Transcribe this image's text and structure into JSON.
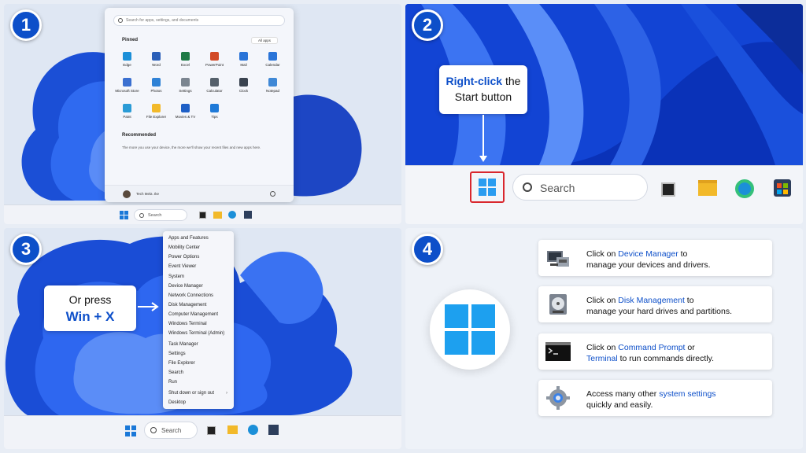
{
  "badges": [
    "1",
    "2",
    "3",
    "4"
  ],
  "panel1": {
    "search_placeholder": "Search for apps, settings, and documents",
    "pinned_label": "Pinned",
    "all_apps_label": "All apps",
    "apps": [
      {
        "label": "Edge",
        "color": "#1b8fd8"
      },
      {
        "label": "Word",
        "color": "#2b5fb8"
      },
      {
        "label": "Excel",
        "color": "#1f7a46"
      },
      {
        "label": "PowerPoint",
        "color": "#d24a26"
      },
      {
        "label": "Mail",
        "color": "#2a74d8"
      },
      {
        "label": "Calendar",
        "color": "#2a74d8"
      },
      {
        "label": "Microsoft Store",
        "color": "#3a6fd0"
      },
      {
        "label": "Photos",
        "color": "#2f82d6"
      },
      {
        "label": "Settings",
        "color": "#7b8590"
      },
      {
        "label": "Calculator",
        "color": "#55606b"
      },
      {
        "label": "Clock",
        "color": "#3a4350"
      },
      {
        "label": "Notepad",
        "color": "#3f88d6"
      },
      {
        "label": "Paint",
        "color": "#2a9bd6"
      },
      {
        "label": "File Explorer",
        "color": "#f2b92a"
      },
      {
        "label": "Movies & TV",
        "color": "#1e5fc6"
      },
      {
        "label": "Tips",
        "color": "#1f7ad8"
      }
    ],
    "recommended_label": "Recommended",
    "recommended_text": "The more you use your device, the more we'll show your recent files and new apps here.",
    "user_name": "Tech Mela .Ike",
    "taskbar_search": "Search"
  },
  "panel2": {
    "callout_bold": "Right-click",
    "callout_rest": " the",
    "callout_line2": "Start button",
    "taskbar_search": "Search"
  },
  "panel3": {
    "menu_items": [
      "Apps and Features",
      "Mobility Center",
      "Power Options",
      "Event Viewer",
      "System",
      "Device Manager",
      "Network Connections",
      "Disk Management",
      "Computer Management",
      "Windows Terminal",
      "Windows Terminal (Admin)",
      "Task Manager",
      "Settings",
      "File Explorer",
      "Search",
      "Run",
      "Shut down or sign out",
      "Desktop"
    ],
    "callout_line1": "Or press",
    "callout_line2": "Win + X",
    "taskbar_search": "Search"
  },
  "panel4": {
    "cards": [
      {
        "pre": "Click on ",
        "link": "Device Manager",
        "post": " to",
        "line2": "manage your devices and drivers.",
        "icon": "device-manager-icon"
      },
      {
        "pre": "Click on ",
        "link": "Disk Management",
        "post": " to",
        "line2": "manage your hard drives and partitions.",
        "icon": "disk-management-icon"
      },
      {
        "pre": "Click on ",
        "link": "Command Prompt",
        "post": " or",
        "line2_link": "Terminal",
        "line2": " to run commands directly.",
        "icon": "command-prompt-icon"
      },
      {
        "pre": "Access many other ",
        "link": "system settings",
        "post": "",
        "line2": "quickly and easily.",
        "icon": "gear-icon"
      }
    ]
  },
  "colors": {
    "accent": "#0d4fc9",
    "highlight_box": "#d9272e"
  }
}
